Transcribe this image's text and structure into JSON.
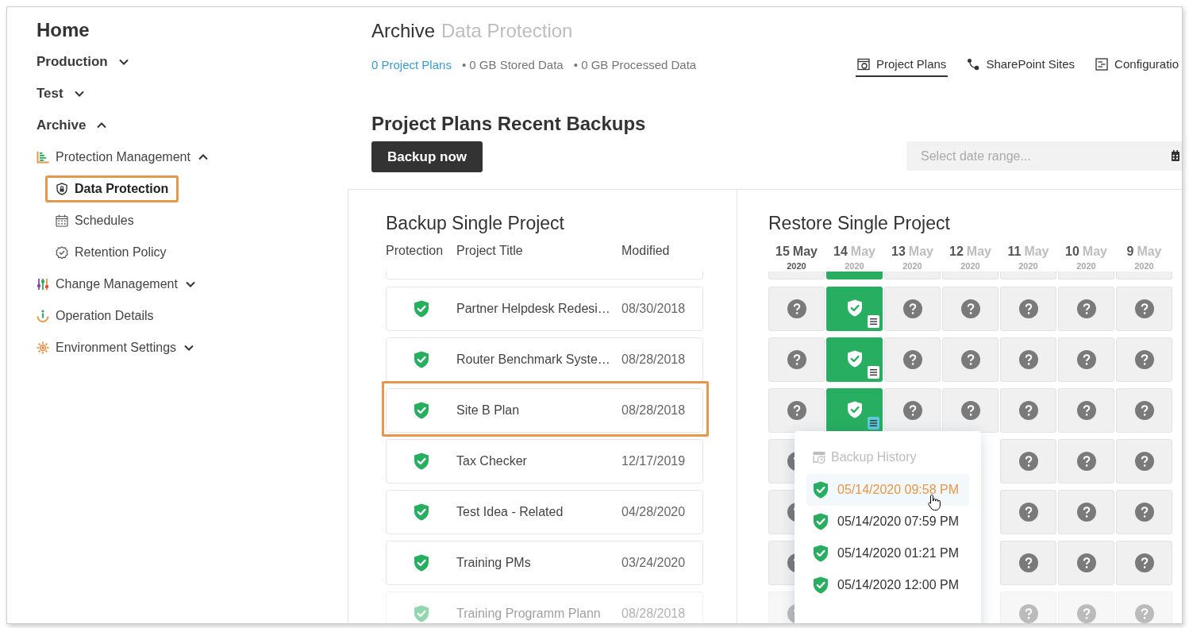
{
  "sidebar": {
    "title": "Home",
    "items": [
      {
        "label": "Production",
        "expanded": false
      },
      {
        "label": "Test",
        "expanded": false
      },
      {
        "label": "Archive",
        "expanded": true,
        "children": [
          {
            "label": "Protection Management",
            "expanded": true,
            "children": [
              {
                "label": "Data Protection",
                "selected": true,
                "annotated": true
              },
              {
                "label": "Schedules",
                "selected": false,
                "annotated": false
              },
              {
                "label": "Retention Policy",
                "selected": false,
                "annotated": false
              }
            ]
          },
          {
            "label": "Change Management",
            "expanded": false
          },
          {
            "label": "Operation Details"
          },
          {
            "label": "Environment Settings",
            "expanded": false
          }
        ]
      }
    ]
  },
  "header": {
    "title": "Archive",
    "breadcrumb": "Data Protection",
    "stats": [
      {
        "text": "0 Project Plans",
        "kind": "link"
      },
      {
        "text": "• 0 GB Stored Data",
        "kind": "plain"
      },
      {
        "text": "• 0 GB Processed Data",
        "kind": "plain"
      }
    ],
    "tabs": [
      {
        "label": "Project Plans",
        "selected": true
      },
      {
        "label": "SharePoint Sites",
        "selected": false
      },
      {
        "label": "Configuratio",
        "selected": false
      }
    ]
  },
  "section": {
    "title": "Project Plans Recent Backups",
    "button": "Backup now",
    "date_range": {
      "placeholder": "Select date range..."
    }
  },
  "backup_panel": {
    "title": "Backup Single Project",
    "columns": [
      "Protection",
      "Project Title",
      "Modified"
    ],
    "rows": [
      {
        "title": "Partner Helpdesk Redesi…",
        "modified": "08/30/2018",
        "protected": true,
        "annotated": false
      },
      {
        "title": "Router Benchmark Syste…",
        "modified": "08/28/2018",
        "protected": true,
        "annotated": false
      },
      {
        "title": "Site B Plan",
        "modified": "08/28/2018",
        "protected": true,
        "annotated": true
      },
      {
        "title": "Tax Checker",
        "modified": "12/17/2019",
        "protected": true,
        "annotated": false
      },
      {
        "title": "Test Idea - Related",
        "modified": "04/28/2020",
        "protected": true,
        "annotated": false
      },
      {
        "title": "Training PMs",
        "modified": "03/24/2020",
        "protected": true,
        "annotated": false
      },
      {
        "title": "Training Programm Plann",
        "modified": "08/28/2018",
        "protected": true,
        "annotated": false
      }
    ]
  },
  "restore_panel": {
    "title": "Restore Single Project",
    "dates": [
      {
        "day": "15",
        "month": "May",
        "year": "2020",
        "current": true
      },
      {
        "day": "14",
        "month": "May",
        "year": "2020",
        "current": false
      },
      {
        "day": "13",
        "month": "May",
        "year": "2020",
        "current": false
      },
      {
        "day": "12",
        "month": "May",
        "year": "2020",
        "current": false
      },
      {
        "day": "11",
        "month": "May",
        "year": "2020",
        "current": false
      },
      {
        "day": "10",
        "month": "May",
        "year": "2020",
        "current": false
      },
      {
        "day": "9",
        "month": "May",
        "year": "2020",
        "current": false
      }
    ],
    "rows": [
      {
        "cells": [
          {
            "kind": "unknown"
          },
          {
            "kind": "backup"
          },
          {
            "kind": "unknown"
          },
          {
            "kind": "unknown"
          },
          {
            "kind": "unknown"
          },
          {
            "kind": "unknown"
          },
          {
            "kind": "unknown"
          }
        ]
      },
      {
        "cells": [
          {
            "kind": "unknown"
          },
          {
            "kind": "backup",
            "menu_open": false
          },
          {
            "kind": "unknown"
          },
          {
            "kind": "unknown"
          },
          {
            "kind": "unknown"
          },
          {
            "kind": "unknown"
          },
          {
            "kind": "unknown"
          }
        ]
      },
      {
        "cells": [
          {
            "kind": "unknown"
          },
          {
            "kind": "backup",
            "menu_open": false
          },
          {
            "kind": "unknown"
          },
          {
            "kind": "unknown"
          },
          {
            "kind": "unknown"
          },
          {
            "kind": "unknown"
          },
          {
            "kind": "unknown"
          }
        ]
      },
      {
        "cells": [
          {
            "kind": "unknown"
          },
          {
            "kind": "backup",
            "menu_open": true
          },
          {
            "kind": "unknown"
          },
          {
            "kind": "unknown"
          },
          {
            "kind": "unknown"
          },
          {
            "kind": "unknown"
          },
          {
            "kind": "unknown"
          }
        ]
      },
      {
        "cells": [
          {
            "kind": "unknown"
          },
          {
            "kind": "covered"
          },
          {
            "kind": "covered"
          },
          {
            "kind": "covered"
          },
          {
            "kind": "unknown"
          },
          {
            "kind": "unknown"
          },
          {
            "kind": "unknown"
          }
        ]
      },
      {
        "cells": [
          {
            "kind": "unknown"
          },
          {
            "kind": "covered"
          },
          {
            "kind": "covered"
          },
          {
            "kind": "covered"
          },
          {
            "kind": "unknown"
          },
          {
            "kind": "unknown"
          },
          {
            "kind": "unknown"
          }
        ]
      },
      {
        "cells": [
          {
            "kind": "unknown"
          },
          {
            "kind": "covered"
          },
          {
            "kind": "covered"
          },
          {
            "kind": "covered"
          },
          {
            "kind": "unknown"
          },
          {
            "kind": "unknown"
          },
          {
            "kind": "unknown"
          }
        ]
      },
      {
        "cells": [
          {
            "kind": "unknown"
          },
          {
            "kind": "covered"
          },
          {
            "kind": "covered"
          },
          {
            "kind": "covered"
          },
          {
            "kind": "unknown"
          },
          {
            "kind": "unknown"
          },
          {
            "kind": "unknown"
          }
        ]
      }
    ],
    "history_menu": {
      "title": "Backup History",
      "entries": [
        {
          "time": "05/14/2020 09:58 PM",
          "hovered": true
        },
        {
          "time": "05/14/2020 07:59 PM",
          "hovered": false
        },
        {
          "time": "05/14/2020 01:21 PM",
          "hovered": false
        },
        {
          "time": "05/14/2020 12:00 PM",
          "hovered": false
        }
      ]
    }
  }
}
